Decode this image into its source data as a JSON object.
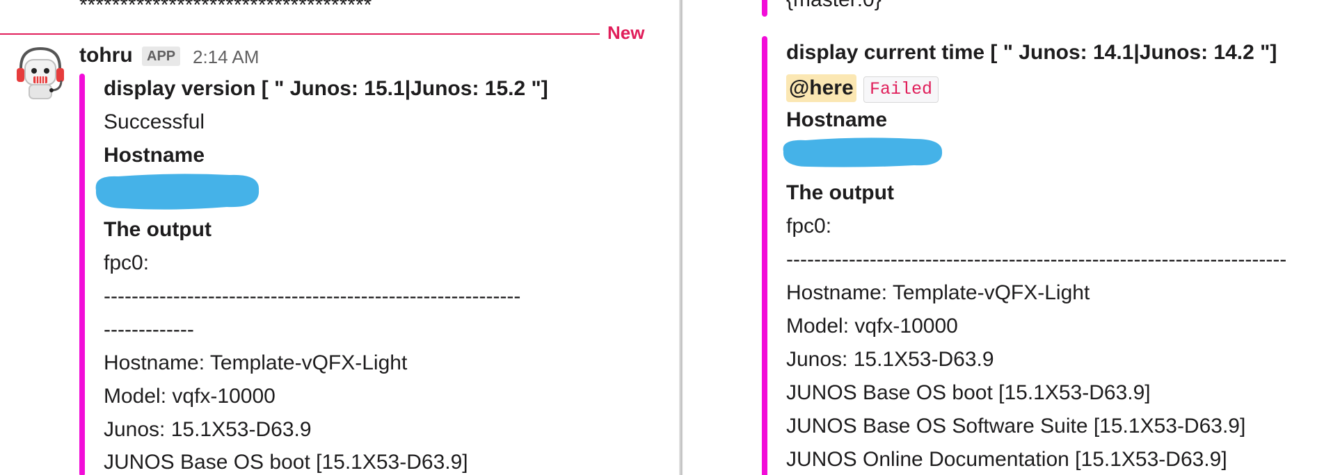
{
  "left": {
    "prev_line": "************************************",
    "new_divider": {
      "label": "New",
      "color": "#e01e5a"
    },
    "message": {
      "avatar": "robot-avatar-icon",
      "username": "tohru",
      "badge": "APP",
      "timestamp": "2:14 AM",
      "attachment": {
        "accent_color": "#f20dd8",
        "title": "display version [ \" Junos: 15.1|Junos: 15.2 \"]",
        "status": "Successful",
        "hostname_label": "Hostname",
        "output_label": "The output",
        "output_lines": [
          "fpc0:",
          "------------------------------------------------------------",
          "-------------",
          "Hostname: Template-vQFX-Light",
          "Model: vqfx-10000",
          "Junos: 15.1X53-D63.9",
          "JUNOS Base OS boot [15.1X53-D63.9]"
        ]
      }
    }
  },
  "right": {
    "prev_line": "{master:0}",
    "attachment": {
      "accent_color": "#f20dd8",
      "title": "display current time [ \" Junos: 14.1|Junos: 14.2 \"]",
      "mention": "@here",
      "status_code": "Failed",
      "hostname_label": "Hostname",
      "output_label": "The output",
      "output_lines": [
        "fpc0:",
        "------------------------------------------------------------------------",
        "Hostname: Template-vQFX-Light",
        "Model: vqfx-10000",
        "Junos: 15.1X53-D63.9",
        "JUNOS Base OS boot [15.1X53-D63.9]",
        "JUNOS Base OS Software Suite [15.1X53-D63.9]",
        "JUNOS Online Documentation [15.1X53-D63.9]"
      ]
    }
  }
}
